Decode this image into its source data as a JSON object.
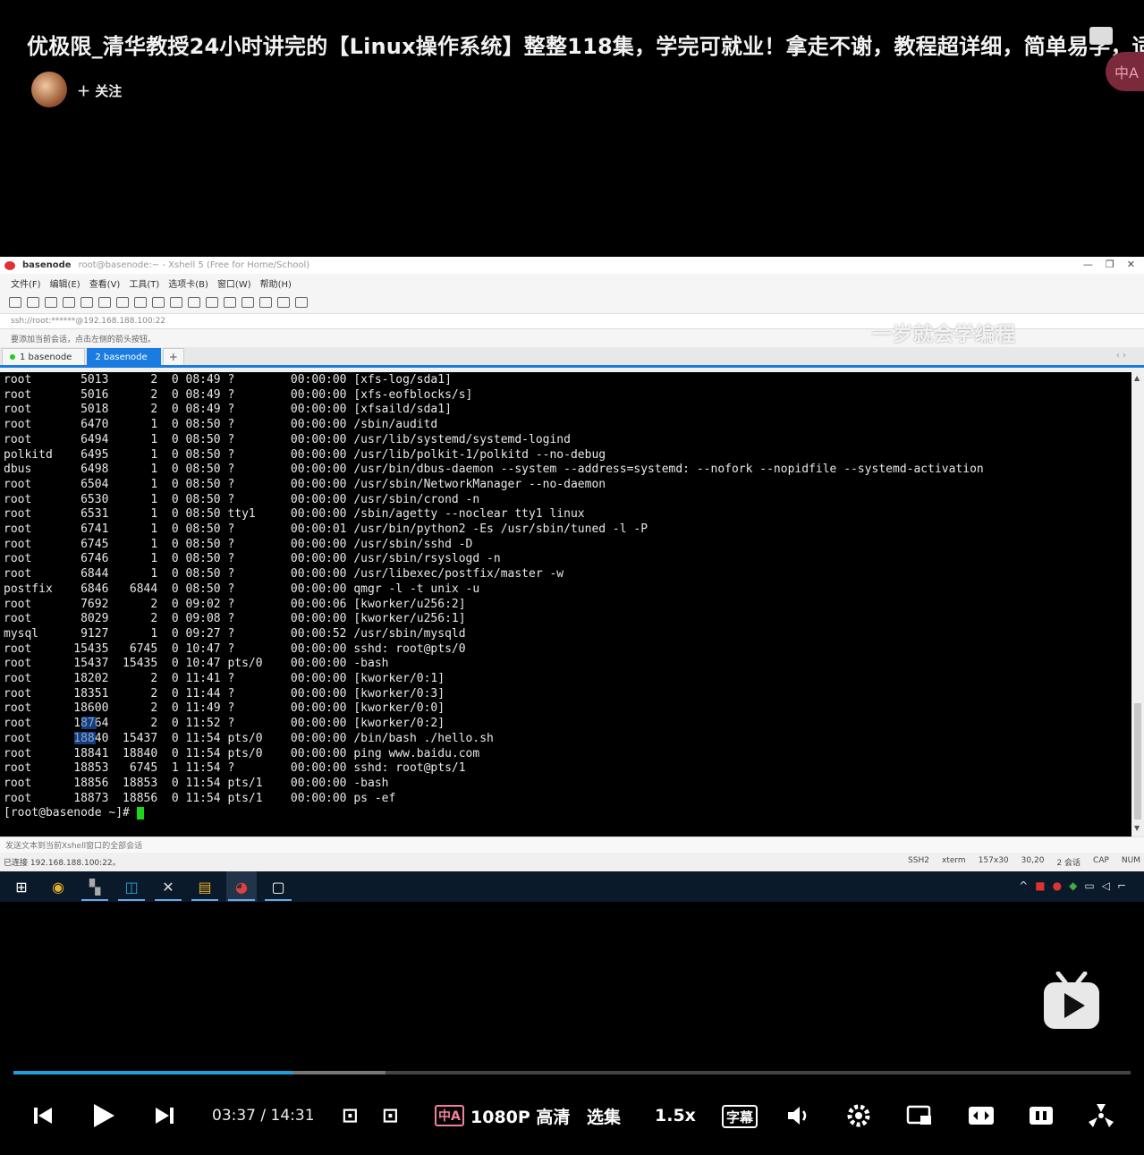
{
  "video": {
    "title": "优极限_清华教授24小时讲完的【Linux操作系统】整整118集，学完可就业！拿走不谢，教程超详细，简单易学，适",
    "follow_label": "＋ 关注",
    "subtitle_toggle_glyph": "中A"
  },
  "xshell": {
    "window_title": "basenode",
    "window_subtitle": "root@basenode:~  - Xshell 5 (Free for Home/School)",
    "menu": [
      "文件(F)",
      "编辑(E)",
      "查看(V)",
      "工具(T)",
      "选项卡(B)",
      "窗口(W)",
      "帮助(H)"
    ],
    "watermark": "一岁就会学编程",
    "address": "ssh://root:******@192.168.188.100:22",
    "hint": "要添加当前会话，点击左侧的箭头按钮。",
    "tabs": [
      {
        "label": "1 basenode",
        "active": false
      },
      {
        "label": "2 basenode",
        "active": true
      }
    ],
    "terminal_lines": [
      "root       5013      2  0 08:49 ?        00:00:00 [xfs-log/sda1]",
      "root       5016      2  0 08:49 ?        00:00:00 [xfs-eofblocks/s]",
      "root       5018      2  0 08:49 ?        00:00:00 [xfsaild/sda1]",
      "root       6470      1  0 08:50 ?        00:00:00 /sbin/auditd",
      "root       6494      1  0 08:50 ?        00:00:00 /usr/lib/systemd/systemd-logind",
      "polkitd    6495      1  0 08:50 ?        00:00:00 /usr/lib/polkit-1/polkitd --no-debug",
      "dbus       6498      1  0 08:50 ?        00:00:00 /usr/bin/dbus-daemon --system --address=systemd: --nofork --nopidfile --systemd-activation",
      "root       6504      1  0 08:50 ?        00:00:00 /usr/sbin/NetworkManager --no-daemon",
      "root       6530      1  0 08:50 ?        00:00:00 /usr/sbin/crond -n",
      "root       6531      1  0 08:50 tty1     00:00:00 /sbin/agetty --noclear tty1 linux",
      "root       6741      1  0 08:50 ?        00:00:01 /usr/bin/python2 -Es /usr/sbin/tuned -l -P",
      "root       6745      1  0 08:50 ?        00:00:00 /usr/sbin/sshd -D",
      "root       6746      1  0 08:50 ?        00:00:00 /usr/sbin/rsyslogd -n",
      "root       6844      1  0 08:50 ?        00:00:00 /usr/libexec/postfix/master -w",
      "postfix    6846   6844  0 08:50 ?        00:00:00 qmgr -l -t unix -u",
      "root       7692      2  0 09:02 ?        00:00:06 [kworker/u256:2]",
      "root       8029      2  0 09:08 ?        00:00:00 [kworker/u256:1]",
      "mysql      9127      1  0 09:27 ?        00:00:52 /usr/sbin/mysqld",
      "root      15435   6745  0 10:47 ?        00:00:00 sshd: root@pts/0",
      "root      15437  15435  0 10:47 pts/0    00:00:00 -bash",
      "root      18202      2  0 11:41 ?        00:00:00 [kworker/0:1]",
      "root      18351      2  0 11:44 ?        00:00:00 [kworker/0:3]",
      "root      18600      2  0 11:49 ?        00:00:00 [kworker/0:0]",
      "root      18764      2  0 11:52 ?        00:00:00 [kworker/0:2]",
      "root      18840  15437  0 11:54 pts/0    00:00:00 /bin/bash ./hello.sh",
      "root      18841  18840  0 11:54 pts/0    00:00:00 ping www.baidu.com",
      "root      18853   6745  1 11:54 ?        00:00:00 sshd: root@pts/1",
      "root      18856  18853  0 11:54 pts/1    00:00:00 -bash",
      "root      18873  18856  0 11:54 pts/1    00:00:00 ps -ef"
    ],
    "prompt": "[root@basenode ~]# ",
    "send_bar": "发送文本到当前Xshell窗口的全部会话",
    "status_left": "已连接 192.168.188.100:22。",
    "status_right": [
      "SSH2",
      "xterm",
      "157x30",
      "30,20",
      "2 会话",
      "CAP",
      "NUM"
    ]
  },
  "player": {
    "current_time": "03:37",
    "separator": "/",
    "duration": "14:31",
    "progress_fraction": 0.251,
    "buffered_fraction": 0.333,
    "quality": "1080P 高清",
    "episodes": "选集",
    "speed": "1.5x",
    "subtitle_label": "字幕",
    "accent_color": "#1e9fe0"
  }
}
